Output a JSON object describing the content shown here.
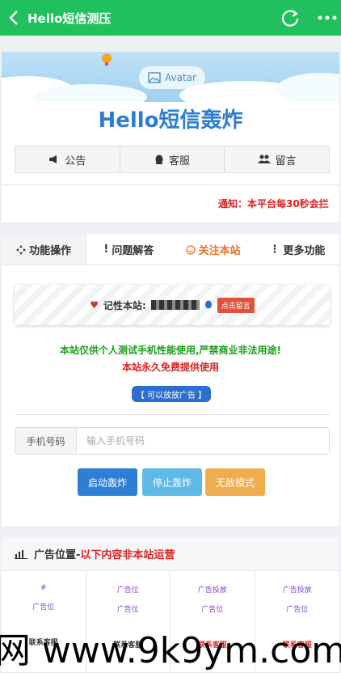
{
  "app_bar": {
    "title": "Hello短信测压",
    "back_icon": "chevron-left-icon",
    "reload_icon": "reload-icon",
    "more_icon": "more-horizontal-icon",
    "color": "#20c05c"
  },
  "banner": {
    "avatar_label": "Avatar"
  },
  "site": {
    "title": "Hello短信轰炸"
  },
  "top_tabs": [
    {
      "label": "公告",
      "icon": "megaphone-icon"
    },
    {
      "label": "客服",
      "icon": "qq-icon"
    },
    {
      "label": "留言",
      "icon": "users-icon"
    }
  ],
  "notice": {
    "text": "通知：本平台每30秒会拦"
  },
  "function_tabs": [
    {
      "label": "功能操作",
      "icon": "move-icon"
    },
    {
      "label": "问题解答",
      "icon": "exclamation-icon"
    },
    {
      "label": "关注本站",
      "icon": "smile-icon"
    },
    {
      "label": "更多功能",
      "icon": "more-vertical-icon"
    }
  ],
  "remember": {
    "label": "记性本站:",
    "message_button": "点击留言"
  },
  "disclaimer": {
    "line1": "本站仅供个人测试手机性能使用,严禁商业非法用途!",
    "line2": "本站永久免费提供使用",
    "ad_button": "【 可以放放广告 】"
  },
  "phone": {
    "label": "手机号码",
    "placeholder": "输入手机号码",
    "value": ""
  },
  "actions": {
    "start": "启动轰炸",
    "stop": "停止轰炸",
    "god_mode": "无敌模式"
  },
  "ad_section": {
    "title_prefix": "广告位置-",
    "title_red": "以下内容非本站运营",
    "cells": [
      {
        "line1": "#",
        "line2": "广告位",
        "contact": "联系客服"
      },
      {
        "line1": "广告位",
        "line2": "广告位",
        "contact": "联系客服"
      },
      {
        "line1": "广告投放",
        "line2": "广告位",
        "contact": "联系客服"
      },
      {
        "line1": "广告投放",
        "line2": "广告位",
        "contact": "联系客服"
      }
    ]
  },
  "watermark": "网 www.9k9ym.com"
}
